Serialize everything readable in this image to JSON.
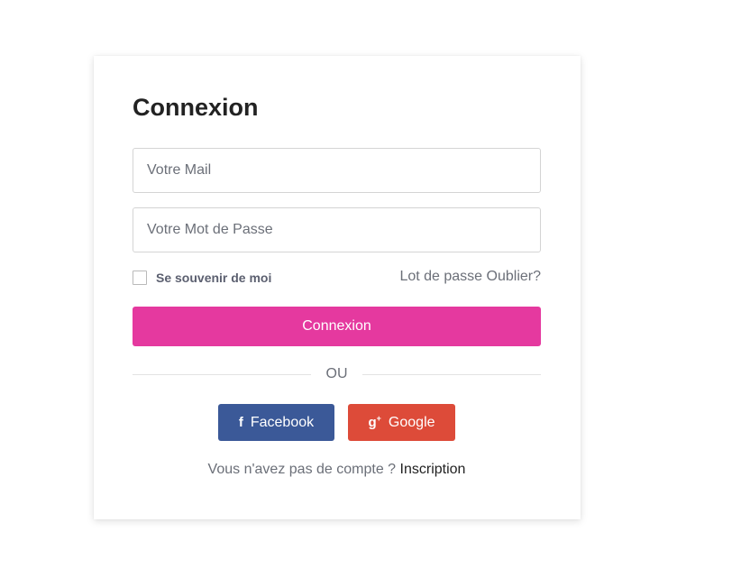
{
  "login": {
    "title": "Connexion",
    "email_placeholder": "Votre Mail",
    "password_placeholder": "Votre Mot de Passe",
    "remember_label": "Se souvenir de moi",
    "remember_checked": false,
    "forgot_link": "Lot de passe Oublier?",
    "submit_label": "Connexion",
    "divider_text": "OU",
    "social": {
      "facebook_label": "Facebook",
      "facebook_icon": "f",
      "facebook_color": "#3b5998",
      "google_label": "Google",
      "google_icon": "g",
      "google_icon_sup": "+",
      "google_color": "#dd4b39"
    },
    "signup_prompt": "Vous n'avez pas de compte ?",
    "signup_link": "Inscription"
  },
  "colors": {
    "accent": "#e5399f",
    "title": "#222222",
    "muted_text": "#6b6f78"
  }
}
